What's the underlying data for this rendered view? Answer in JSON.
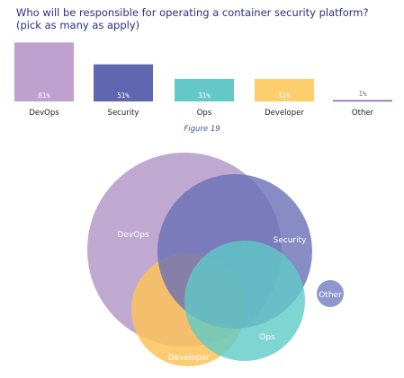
{
  "title_line1": "Who will be responsible for operating a container security platform?",
  "title_line2": "(pick as many as apply)",
  "figure_caption": "Figure 19",
  "chart_data": [
    {
      "type": "bar",
      "categories": [
        "DevOps",
        "Security",
        "Ops",
        "Developer",
        "Other"
      ],
      "values": [
        81,
        51,
        31,
        31,
        1
      ],
      "value_labels": [
        "81%",
        "51%",
        "31%",
        "31%",
        "1%"
      ],
      "colors": [
        "#bfa0cf",
        "#6166b0",
        "#64c8c8",
        "#fccf6c",
        "#8e5fa8"
      ],
      "ylim": [
        0,
        100
      ],
      "grid": false
    },
    {
      "type": "venn",
      "sets": [
        {
          "name": "DevOps",
          "value": 81,
          "color": "#b49ac9",
          "opacity": 0.85
        },
        {
          "name": "Developer",
          "value": 31,
          "color": "#fbc35a",
          "opacity": 0.85
        },
        {
          "name": "Security",
          "value": 51,
          "color": "#6a6fb5",
          "opacity": 0.8
        },
        {
          "name": "Ops",
          "value": 31,
          "color": "#5fcac7",
          "opacity": 0.8
        },
        {
          "name": "Other",
          "value": 1,
          "color": "#8f98cd",
          "opacity": 1
        }
      ]
    }
  ]
}
